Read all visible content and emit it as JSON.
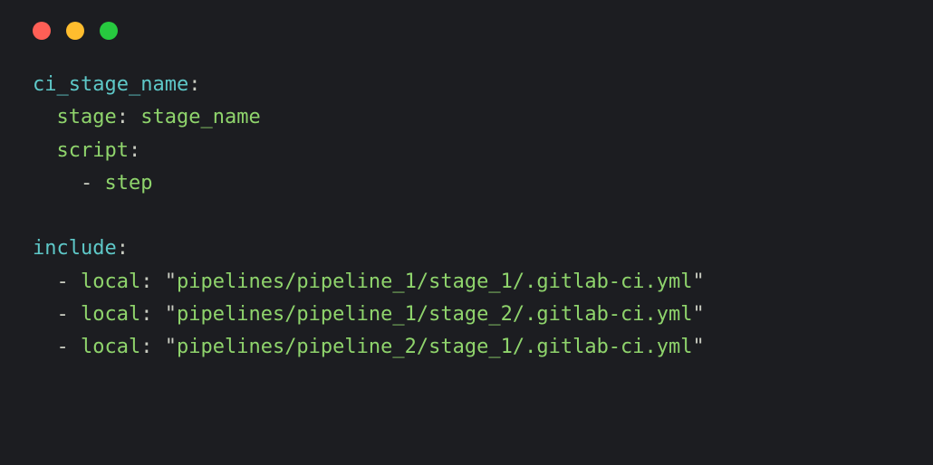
{
  "window": {
    "dots": [
      "red",
      "yellow",
      "green"
    ]
  },
  "code": {
    "job_key": "ci_stage_name",
    "stage_key": "stage",
    "stage_value": "stage_name",
    "script_key": "script",
    "script_step": "step",
    "include_key": "include",
    "includes": [
      {
        "key": "local",
        "path": "pipelines/pipeline_1/stage_1/.gitlab-ci.yml"
      },
      {
        "key": "local",
        "path": "pipelines/pipeline_1/stage_2/.gitlab-ci.yml"
      },
      {
        "key": "local",
        "path": "pipelines/pipeline_2/stage_1/.gitlab-ci.yml"
      }
    ]
  },
  "colors": {
    "bg": "#1c1d21",
    "cyan": "#5ec8c8",
    "green": "#8fd46c",
    "plain": "#c8cbc0",
    "red": "#ff5f56",
    "yellow": "#ffbd2e",
    "greenDot": "#27c93f"
  }
}
